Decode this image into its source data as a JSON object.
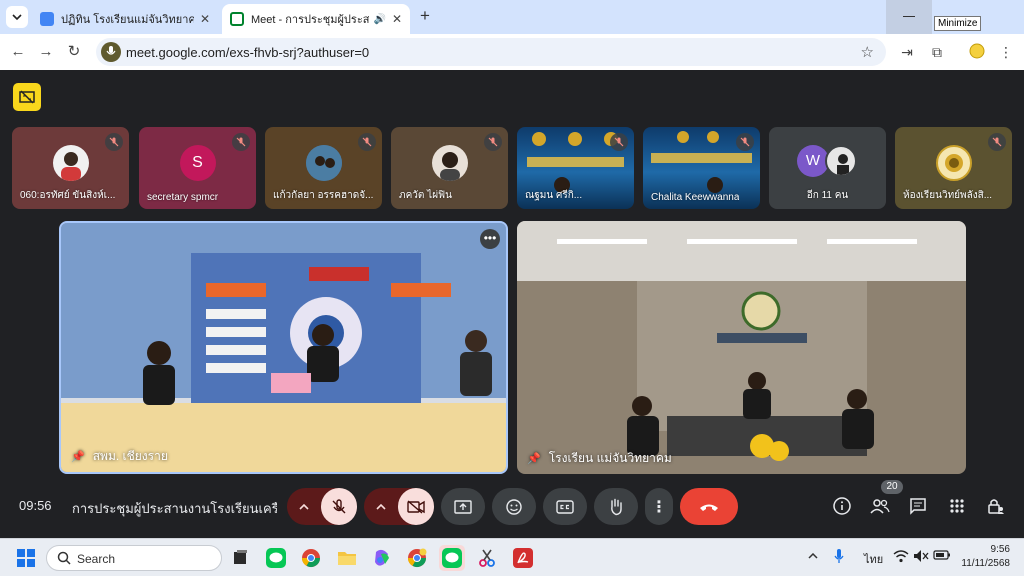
{
  "browser": {
    "tabs": [
      {
        "title": "ปฏิทิน โรงเรียนแม่จันวิทยาคม - วันอั",
        "active": false,
        "favicon_color": "#1a73e8"
      },
      {
        "title": "Meet - การประชุมผู้ประสานงานโ",
        "active": true,
        "favicon_color": "#00832d"
      }
    ],
    "new_tab_label": "+",
    "tooltip": "Minimize",
    "url": "meet.google.com/exs-fhvb-srj?authuser=0"
  },
  "meet": {
    "tiles": [
      {
        "name": "060:อรทัศย์ ขันสิงห์เ...",
        "muted": true,
        "bg": "#6d3a3a"
      },
      {
        "name": "secretary spmcr",
        "muted": true,
        "bg": "#7d2a45",
        "initial": "S"
      },
      {
        "name": "แก้วกัลยา อรรคฮาดจั...",
        "muted": true,
        "bg": "#5a4327"
      },
      {
        "name": "ภควัต ไผ่ฟิน",
        "muted": true,
        "bg": "#5a4836"
      },
      {
        "name": "ณฐมน ศรีกิ...",
        "muted": true,
        "bg": "#2f5f86"
      },
      {
        "name": "Chalita Keewwanna",
        "muted": true,
        "bg": "#26587d"
      },
      {
        "name": "อีก 11 คน",
        "muted": false,
        "bg": "#3c4043",
        "initial": "W"
      },
      {
        "name": "ห้องเรียนวิทย์พลังสิ...",
        "muted": true,
        "bg": "#5b5230"
      }
    ],
    "stage": [
      {
        "label": "สพม. เชียงราย",
        "bg": "#6b87b8"
      },
      {
        "label": "โรงเรียน แม่จันวิทยาคม",
        "bg": "#8a7e6d"
      }
    ],
    "clock": "09:56",
    "title": "การประชุมผู้ประสานงานโรงเรียนเครือ...",
    "participant_count": "20"
  },
  "taskbar": {
    "search_placeholder": "Search",
    "lang": "ไทย",
    "time": "9:56",
    "date": "11/11/2568"
  }
}
